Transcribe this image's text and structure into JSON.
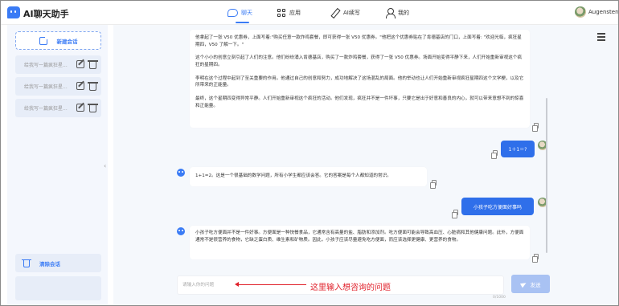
{
  "app": {
    "title": "AI聊天助手",
    "colors": {
      "accent": "#3a7bf5",
      "user_bubble": "#2f6fea",
      "send_disabled": "#a9c2f3",
      "annotation": "#e0212b"
    }
  },
  "nav": [
    {
      "label": "聊天",
      "icon": "chat-bubble-icon",
      "active": true
    },
    {
      "label": "应用",
      "icon": "grid-icon",
      "active": false
    },
    {
      "label": "AI续写",
      "icon": "pen-icon",
      "active": false
    },
    {
      "label": "我的",
      "icon": "user-icon",
      "active": false
    }
  ],
  "user": {
    "name": "Augenstern"
  },
  "sidebar": {
    "new_chat_label": "新建会话",
    "conversations": [
      {
        "title": "给我写一篇疯狂星..."
      },
      {
        "title": "给我写一篇疯狂星..."
      },
      {
        "title": "给我写一篇疯狂星..."
      }
    ],
    "clear_label": "清除会话"
  },
  "messages": [
    {
      "role": "assistant",
      "paragraphs": [
        "他拿起了一张 V50 优惠券，上面写着:\"购买任意一款炸鸡套餐，即可获得一张 V50 优惠券。\"他把这个优惠券贴在了肯德基店的门口，上面写着: \"欢迎光临，疯狂星期四，V50 了解一下。\"",
        "这个小小的创意立刻引起了人们的注意。他们纷纷涌入肯德基店，购买了一款炸鸡套餐，获得了一张 V50 优惠券。场面开始变得平静下来，人们开始重新审视这个疯狂的星期四。",
        "李明在这个过程中起到了至关重要的作用。他通过自己的创意和努力，成功地解决了这场混乱的局面。他的举动也让人们开始重新审视疯狂星期四这个文学梗，以及它所带来的正能量。",
        "最终，这个星期四变得异常平静。人们开始重新审视这个疯狂的活动。他们发现，疯狂并不是一件坏事，只要它是出于好意和善良的内心，就可以带来意想不到的惊喜和正能量。"
      ]
    },
    {
      "role": "user",
      "text": "1＋1＝?"
    },
    {
      "role": "assistant",
      "paragraphs": [
        "1+1=2。这是一个很基础的数学问题，所有小学生都应该会答。它的答案是每个人都知道的常识。"
      ]
    },
    {
      "role": "user",
      "text": "小孩子吃方便面好事吗"
    },
    {
      "role": "assistant",
      "paragraphs": [
        "小孩子吃方便面并不是一件好事。方便面是一种快餐食品，它通常含有高量的盐、脂肪和添加剂。吃方便面可能会导致高血压、心脏病和其他健康问题。此外，方便面通常不是很营养的食物，它缺乏蛋白质、维生素和矿物质。因此，小孩子应该尽量避免吃方便面，而应该选择更健康、更营养的食物。"
      ]
    }
  ],
  "input": {
    "placeholder": "请输入你的问题",
    "hint": "",
    "char_count": "0/1000"
  },
  "send_label": "发送",
  "annotation": "这里输入想咨询的问题"
}
